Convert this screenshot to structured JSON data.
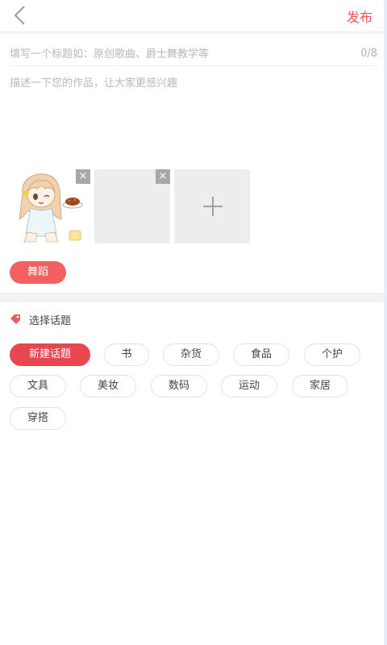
{
  "header": {
    "back_icon": "chevron-left-icon",
    "publish_label": "发布",
    "accent_color": "#f05454"
  },
  "form": {
    "title_placeholder": "填写一个标题如：原创歌曲、爵士舞教学等",
    "title_value": "",
    "title_counter": "0/8",
    "description_placeholder": "描述一下您的作品，让大家更感兴趣",
    "description_value": ""
  },
  "images": {
    "remove_icon": "close-icon",
    "add_icon": "plus-icon",
    "remove_symbol": "×"
  },
  "selected_topic": "舞蹈",
  "topics": {
    "section_icon": "tag-icon",
    "section_label": "选择话题",
    "new_topic_label": "新建话题",
    "items": [
      "书",
      "杂货",
      "食品",
      "个护",
      "文具",
      "美妆",
      "数码",
      "运动",
      "家居",
      "穿搭"
    ]
  }
}
